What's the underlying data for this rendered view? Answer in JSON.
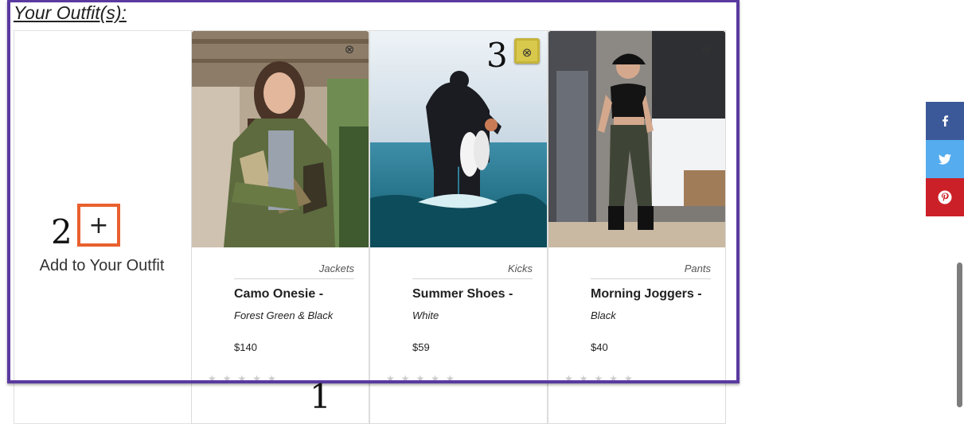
{
  "section_title": "Your Outfit(s):",
  "add_card": {
    "plus": "+",
    "label": "Add to Your Outfit"
  },
  "annotations": {
    "one": "1",
    "two": "2",
    "three": "3"
  },
  "remove_icon": "⊗",
  "cards": [
    {
      "category": "Jackets",
      "name": "Camo Onesie",
      "style": "Forest Green & Black",
      "price": "$140"
    },
    {
      "category": "Kicks",
      "name": "Summer Shoes",
      "style": "White",
      "price": "$59"
    },
    {
      "category": "Pants",
      "name": "Morning Joggers",
      "style": "Black",
      "price": "$40"
    }
  ],
  "name_separator": "-",
  "social": [
    {
      "icon": "facebook-icon",
      "color": "#3b5998"
    },
    {
      "icon": "twitter-icon",
      "color": "#55acee"
    },
    {
      "icon": "pinterest-icon",
      "color": "#cb2027"
    }
  ],
  "colors": {
    "outline": "#5a3aa0",
    "add_highlight": "#e9602e",
    "remove_highlight": "#d8c84b"
  }
}
